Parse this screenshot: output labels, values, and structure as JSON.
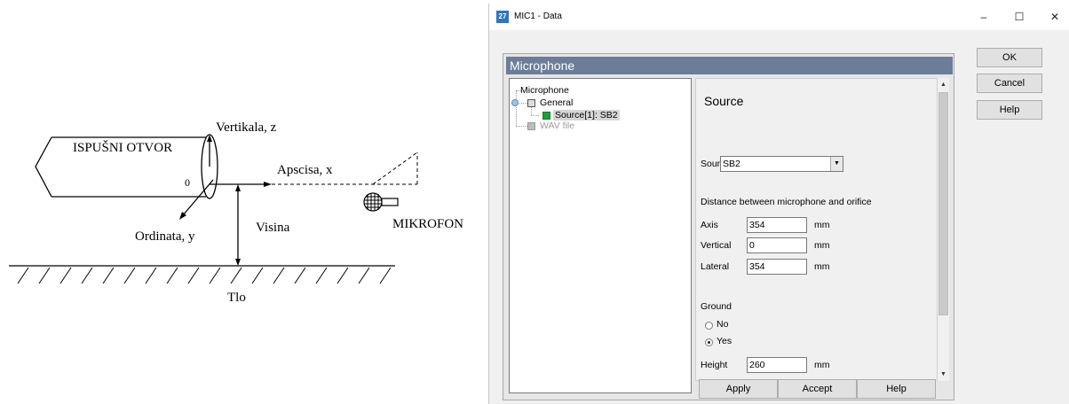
{
  "diagram": {
    "vertical_label": "Vertikala, z",
    "exhaust_label": "ISPUŠNI OTVOR",
    "abscissa_label": "Apscisa, x",
    "origin_label": "0",
    "microphone_label": "MIKROFON",
    "height_label": "Visina",
    "ordinate_label": "Ordinata, y",
    "ground_label": "Tlo"
  },
  "window": {
    "title": "MIC1 - Data",
    "icon": "app-icon",
    "min_glyph": "–",
    "max_glyph": "☐",
    "close_glyph": "✕"
  },
  "panel": {
    "header": "Microphone"
  },
  "tree": {
    "root": "Microphone",
    "general": "General",
    "source": "Source[1]: SB2",
    "wav": "WAV file"
  },
  "form": {
    "title": "Source",
    "source_label": "Source",
    "source_value": "SB2",
    "distance_heading": "Distance between microphone and orifice",
    "axis_label": "Axis",
    "axis_value": "354",
    "vertical_label": "Vertical",
    "vertical_value": "0",
    "lateral_label": "Lateral",
    "lateral_value": "354",
    "unit": "mm",
    "ground_heading": "Ground",
    "ground_no": "No",
    "ground_yes": "Yes",
    "ground_selected": "Yes",
    "height_label": "Height",
    "height_value": "260"
  },
  "bottom_buttons": {
    "apply": "Apply",
    "accept": "Accept",
    "help": "Help"
  },
  "right_buttons": {
    "ok": "OK",
    "cancel": "Cancel",
    "help": "Help"
  },
  "colors": {
    "header_bg": "#6b7d99",
    "selected_node": "#1e9e3a",
    "selected_bg": "#d6d6d6"
  }
}
